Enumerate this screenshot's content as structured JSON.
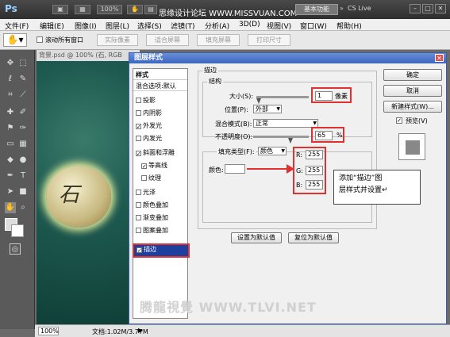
{
  "topbar": {
    "logo": "Ps",
    "zoom": "100%",
    "watermark": "思缘设计论坛 WWW.MISSVUAN.COM",
    "workspace": "基本功能",
    "cslive": "CS Live"
  },
  "menubar": [
    "文件(F)",
    "编辑(E)",
    "图像(I)",
    "图层(L)",
    "选择(S)",
    "滤镜(T)",
    "分析(A)",
    "3D(D)",
    "视图(V)",
    "窗口(W)",
    "帮助(H)"
  ],
  "options": {
    "scroll_all": "滚动所有窗口",
    "actual_pixels": "实际像素",
    "fit_screen": "适合屏幕",
    "fill_screen": "填充屏幕",
    "print_size": "打印尺寸"
  },
  "document": {
    "tab": "背景.psd @ 100% (石, RGB",
    "stone_text": "石",
    "zoom": "100%",
    "doc_info": "文档:1.02M/3.77M"
  },
  "dialog": {
    "title": "图层样式",
    "styles_header": "样式",
    "blend_options": "混合选项:默认",
    "styles": [
      {
        "label": "投影",
        "checked": false
      },
      {
        "label": "内阴影",
        "checked": false
      },
      {
        "label": "外发光",
        "checked": true
      },
      {
        "label": "内发光",
        "checked": false
      },
      {
        "label": "斜面和浮雕",
        "checked": true
      },
      {
        "label": "等高线",
        "checked": true
      },
      {
        "label": "纹理",
        "checked": false
      },
      {
        "label": "光泽",
        "checked": false
      },
      {
        "label": "颜色叠加",
        "checked": false
      },
      {
        "label": "渐变叠加",
        "checked": false
      },
      {
        "label": "图案叠加",
        "checked": false
      }
    ],
    "selected_style": "描边",
    "section_title": "描边",
    "structure_title": "结构",
    "size_label": "大小(S):",
    "size_value": "1",
    "size_unit": "像素",
    "position_label": "位置(P):",
    "position_value": "外部",
    "blend_label": "混合模式(B):",
    "blend_value": "正常",
    "opacity_label": "不透明度(O):",
    "opacity_value": "65",
    "opacity_unit": "%",
    "fill_type_label": "填充类型(F):",
    "fill_type_value": "颜色",
    "color_label": "颜色:",
    "rgb": {
      "r_label": "R:",
      "r": "255",
      "g_label": "G:",
      "g": "255",
      "b_label": "B:",
      "b": "255"
    },
    "make_default": "设置为默认值",
    "reset_default": "复位为默认值",
    "ok": "确定",
    "cancel": "取消",
    "new_style": "新建样式(W)...",
    "preview": "预览(V)"
  },
  "annotation": {
    "line1": "添加“描边”图",
    "line2": "层样式并设置↵"
  },
  "bottom_watermark": "腾龍視覺 WWW.TLVI.NET",
  "colors": {
    "accent": "#e03030",
    "selection": "#1f3f9f",
    "title_blue": "#3b66c0"
  }
}
